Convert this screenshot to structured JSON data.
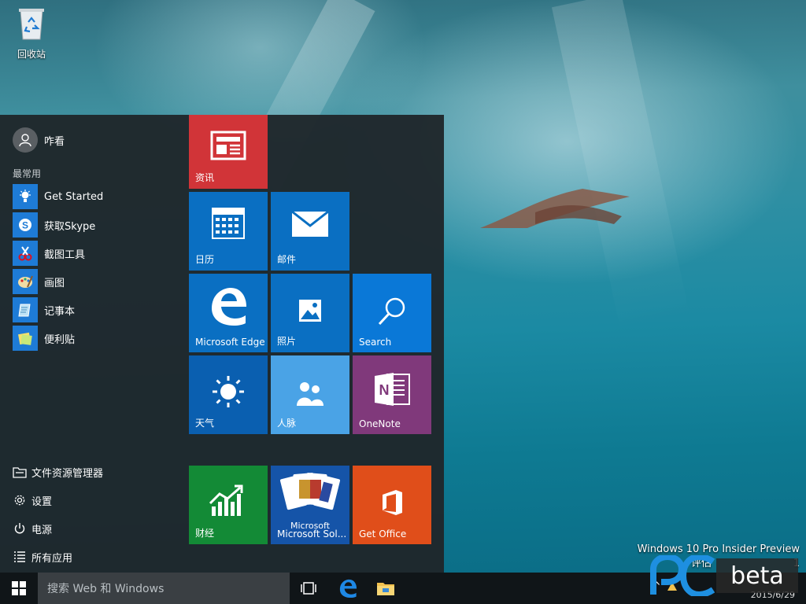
{
  "desktop": {
    "recycle_bin_label": "回收站",
    "watermark_line1": "Windows 10 Pro Insider Preview",
    "watermark_line2": "评估",
    "watermark_build": "1",
    "pcbeta_text": "beta",
    "tray_date": "2015/6/29"
  },
  "start_menu": {
    "user_name": "咋看",
    "most_used_label": "最常用",
    "most_used": [
      {
        "label": "Get Started",
        "icon": "lightbulb-icon"
      },
      {
        "label": "获取Skype",
        "icon": "skype-icon"
      },
      {
        "label": "截图工具",
        "icon": "scissors-icon"
      },
      {
        "label": "画图",
        "icon": "paint-icon"
      },
      {
        "label": "记事本",
        "icon": "notepad-icon"
      },
      {
        "label": "便利贴",
        "icon": "sticky-notes-icon"
      }
    ],
    "bottom_items": [
      {
        "label": "文件资源管理器",
        "icon": "folder-icon"
      },
      {
        "label": "设置",
        "icon": "gear-icon"
      },
      {
        "label": "电源",
        "icon": "power-icon"
      },
      {
        "label": "所有应用",
        "icon": "list-icon"
      }
    ],
    "tiles": [
      {
        "label": "资讯",
        "icon": "news-icon",
        "color": "#d13438"
      },
      {
        "label": "日历",
        "icon": "calendar-icon",
        "color": "#0a6fc2"
      },
      {
        "label": "邮件",
        "icon": "mail-icon",
        "color": "#0a6fc2"
      },
      {
        "label": "Microsoft Edge",
        "icon": "edge-icon",
        "color": "#0a6fc2"
      },
      {
        "label": "照片",
        "icon": "photo-icon",
        "color": "#0a6fc2"
      },
      {
        "label": "Search",
        "icon": "search-icon",
        "color": "#0a78d7"
      },
      {
        "label": "天气",
        "icon": "sun-icon",
        "color": "#0a5fb0"
      },
      {
        "label": "人脉",
        "icon": "people-icon",
        "color": "#4aa3e6"
      },
      {
        "label": "OneNote",
        "icon": "onenote-icon",
        "color": "#80397b"
      },
      {
        "label": "财经",
        "icon": "finance-icon",
        "color": "#138a36"
      },
      {
        "label": "Microsoft Sol...",
        "icon": "cards-icon",
        "color": "#1554a8",
        "art_text": "Microsoft"
      },
      {
        "label": "Get Office",
        "icon": "office-icon",
        "color": "#e04e1a"
      }
    ]
  },
  "taskbar": {
    "search_placeholder": "搜索 Web 和 Windows",
    "buttons": [
      "task-view-icon",
      "edge-icon",
      "file-explorer-icon"
    ]
  }
}
